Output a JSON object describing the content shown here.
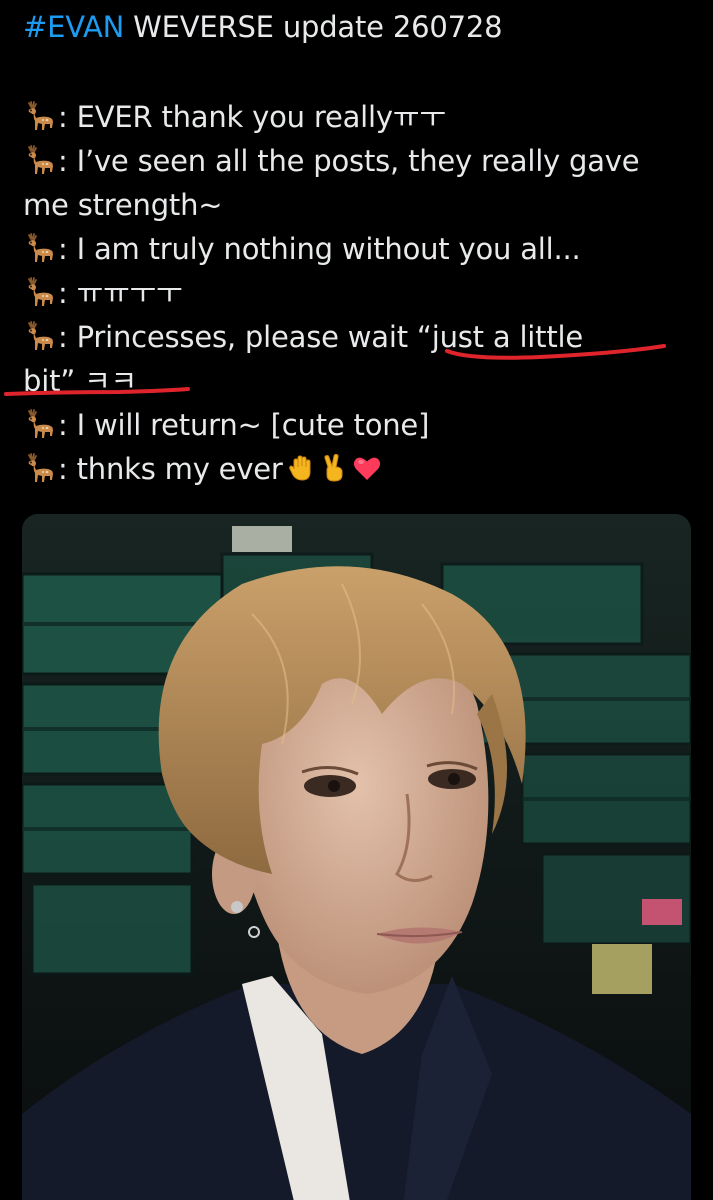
{
  "tweet": {
    "hashtag": "#EVAN",
    "headline_rest": " WEVERSE update 260728",
    "lines": [
      {
        "prefix": ": ",
        "text": "EVER thank you reallyㅠㅜ"
      },
      {
        "prefix": ": ",
        "text": "I’ve seen all the posts, they really gave"
      },
      {
        "prefix": "",
        "text": "me strength~"
      },
      {
        "prefix": ": ",
        "text": "I am truly nothing without you all..."
      },
      {
        "prefix": ": ",
        "text": "ㅠㅠㅜㅜ"
      },
      {
        "prefix": ": ",
        "text": "Princesses, please wait “just a little"
      },
      {
        "prefix": "",
        "text": "bit” ㅋㅋ"
      },
      {
        "prefix": ": ",
        "text": "I will return~ [cute tone]"
      },
      {
        "prefix": ": ",
        "text": "thnks my ever"
      }
    ],
    "line_emoji": "deer-icon",
    "final_emojis": [
      "raised-hand-icon",
      "victory-hand-icon",
      "red-heart-icon"
    ],
    "annotation_color": "#e0242c"
  },
  "media": {
    "kind": "selfie photo",
    "colors": {
      "background": "#0d1314",
      "crates": "#1d5a4c",
      "hair": "#b88a52",
      "skin": "#d7b49e",
      "jacket": "#141a2a",
      "collar": "#e8e6e2"
    }
  }
}
